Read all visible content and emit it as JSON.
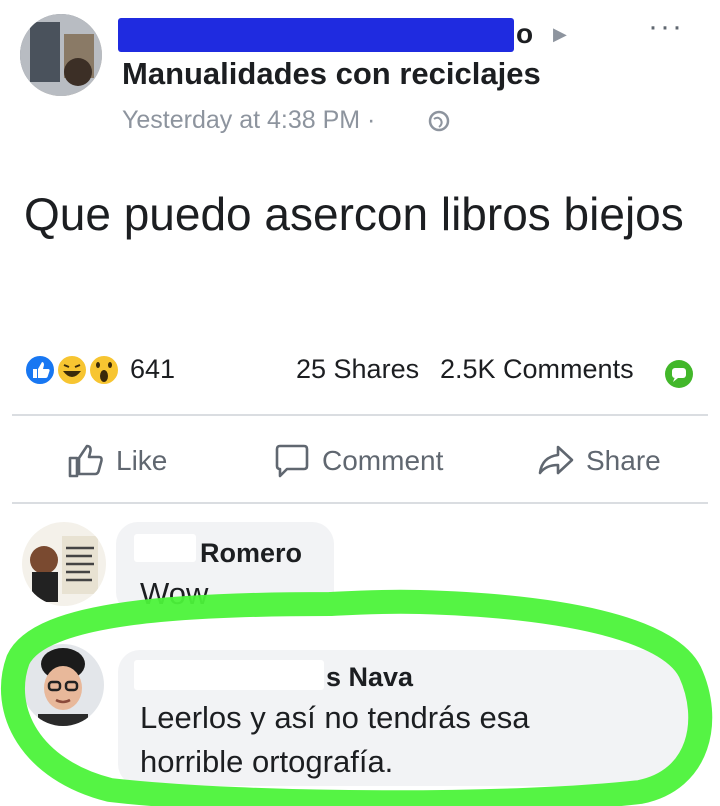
{
  "post": {
    "author_suffix": "o",
    "group": "Manualidades con reciclajes",
    "time": "Yesterday at 4:38 PM ·",
    "text": "Que puedo asercon libros biejos"
  },
  "stats": {
    "reactions": "641",
    "shares": "25 Shares",
    "comments": "2.5K Comments"
  },
  "actions": {
    "like": "Like",
    "comment": "Comment",
    "share": "Share"
  },
  "comments": [
    {
      "name": "Romero",
      "text": "Wow"
    },
    {
      "name": "s Nava",
      "text_line1": "Leerlos y así no tendrás esa",
      "text_line2": "horrible ortografía."
    }
  ],
  "colors": {
    "redaction": "#1f2be0",
    "highlight": "#4cf33a",
    "like_blue": "#1877f2"
  }
}
